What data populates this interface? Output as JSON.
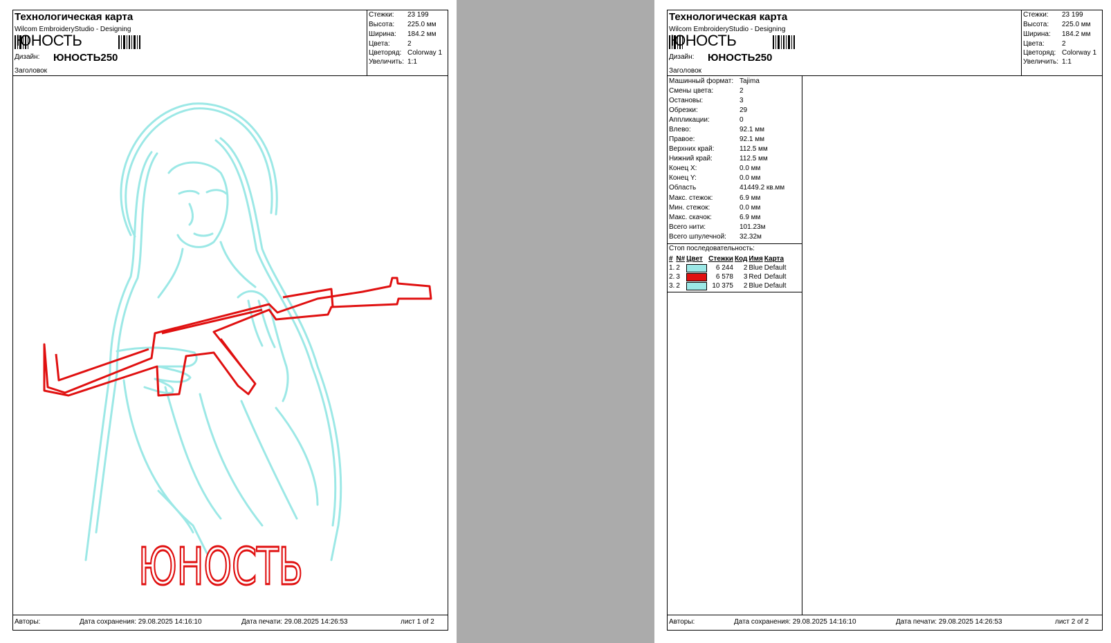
{
  "header": {
    "title": "Технологическая карта",
    "subtitle": "Wilcom EmbroideryStudio - Designing",
    "barcode_text": "ЮНОСТЬ",
    "design_label": "Дизайн:",
    "design_value": "ЮНОСТЬ250",
    "heading_label": "Заголовок"
  },
  "info": [
    {
      "label": "Стежки:",
      "value": "23 199"
    },
    {
      "label": "Высота:",
      "value": "225.0 мм"
    },
    {
      "label": "Ширина:",
      "value": "184.2 мм"
    },
    {
      "label": "Цвета:",
      "value": "2"
    },
    {
      "label": "Цветоряд:",
      "value": "Colorway 1"
    },
    {
      "label": "Увеличить:",
      "value": "1:1"
    }
  ],
  "design_text": "ЮНОСТЬ",
  "colors": {
    "thread_blue": "#9ce8e6",
    "thread_red": "#e01010",
    "background": "#ababab"
  },
  "stats": [
    {
      "label": "Машинный формат:",
      "value": "Tajima"
    },
    {
      "label": "Смены цвета:",
      "value": "2"
    },
    {
      "label": "Остановы:",
      "value": "3"
    },
    {
      "label": "Обрезки:",
      "value": "29"
    },
    {
      "label": "Аппликации:",
      "value": "0"
    },
    {
      "label": "Влево:",
      "value": "92.1 мм"
    },
    {
      "label": "Правое:",
      "value": "92.1 мм"
    },
    {
      "label": "Верхних край:",
      "value": "112.5 мм"
    },
    {
      "label": "Нижний край:",
      "value": "112.5 мм"
    },
    {
      "label": "Конец X:",
      "value": "0.0 мм"
    },
    {
      "label": "Конец Y:",
      "value": "0.0 мм"
    },
    {
      "label": "Область",
      "value": "41449.2 кв.мм"
    },
    {
      "label": "Макс. стежок:",
      "value": "6.9 мм"
    },
    {
      "label": "Мин. стежок:",
      "value": "0.0 мм"
    },
    {
      "label": "Макс. скачок:",
      "value": "6.9 мм"
    },
    {
      "label": "Всего нити:",
      "value": "101.23м"
    },
    {
      "label": "Всего шпулечной:",
      "value": "32.32м"
    }
  ],
  "stop_title": "Стоп последовательность:",
  "stop_headers": [
    "#",
    "N#",
    "Цвет",
    "Стежки",
    "Код",
    "Имя",
    "Карта"
  ],
  "stop_rows": [
    {
      "num": "1.",
      "n": "2",
      "color": "#9ce8e6",
      "stitches": "6 244",
      "code": "2",
      "name": "Blue",
      "card": "Default"
    },
    {
      "num": "2.",
      "n": "3",
      "color": "#e01010",
      "stitches": "6 578",
      "code": "3",
      "name": "Red",
      "card": "Default"
    },
    {
      "num": "3.",
      "n": "2",
      "color": "#9ce8e6",
      "stitches": "10 375",
      "code": "2",
      "name": "Blue",
      "card": "Default"
    }
  ],
  "footer": {
    "authors": "Авторы:",
    "saved": "Дата сохранения: 29.08.2025 14:16:10",
    "printed": "Дата печати: 29.08.2025 14:26:53",
    "sheet1": "лист 1 of 2",
    "sheet2": "лист 2 of 2"
  }
}
